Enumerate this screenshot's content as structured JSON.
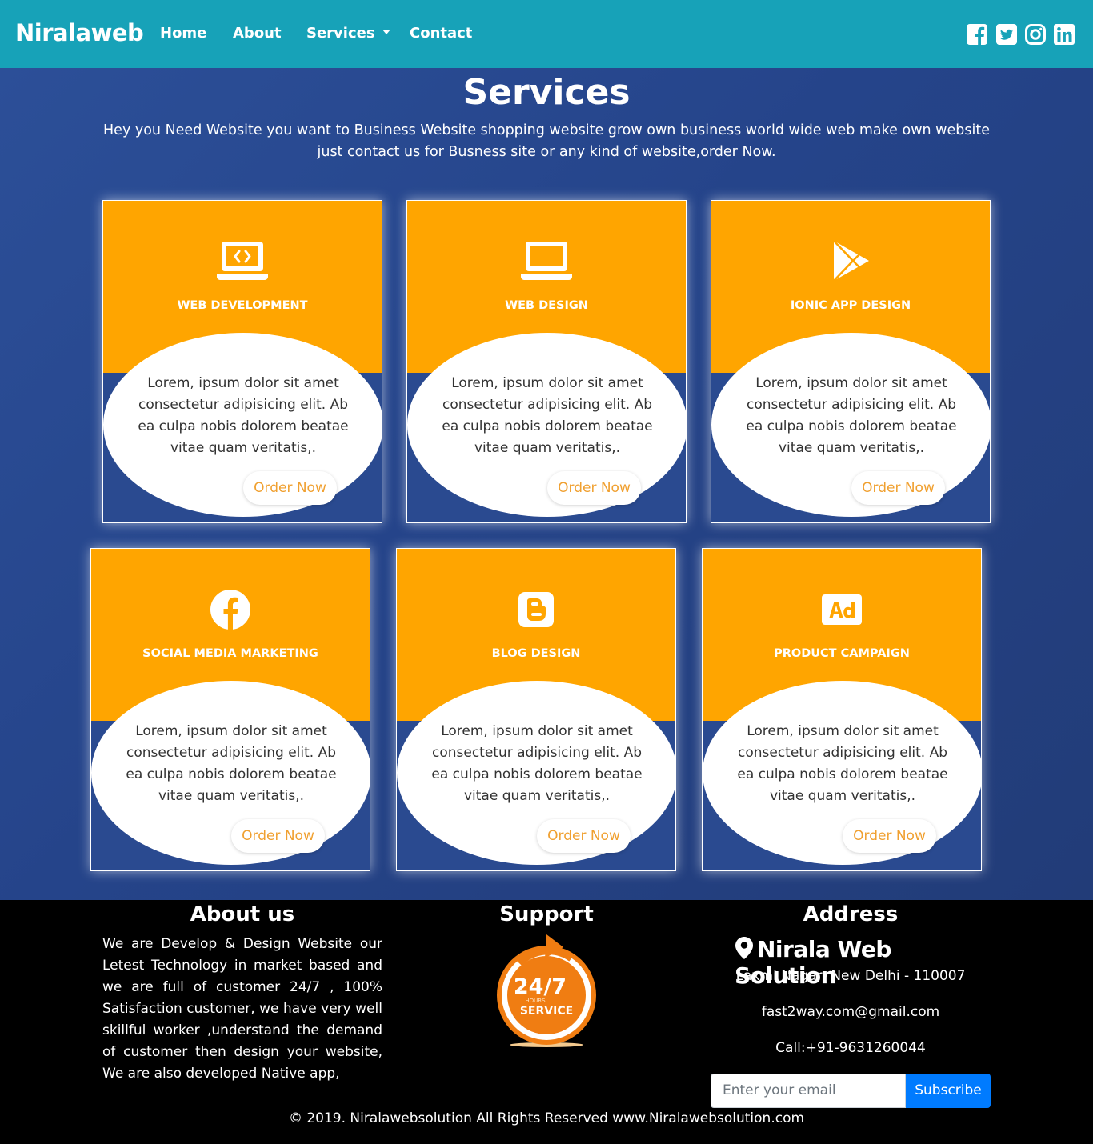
{
  "navbar": {
    "brand": "Niralaweb",
    "links": [
      "Home",
      "About",
      "Services",
      "Contact"
    ],
    "social_icons": [
      "facebook-square-icon",
      "twitter-square-icon",
      "instagram-icon",
      "linkedin-icon"
    ]
  },
  "hero": {
    "title": "Services",
    "description": "Hey you Need Website you want to Business Website shopping website grow own business world wide web make own website just contact us for Busness site or any kind of website,order Now."
  },
  "cards": [
    {
      "icon": "laptop-code-icon",
      "title": "WEB DEVELOPMENT",
      "text": "Lorem, ipsum dolor sit amet consectetur adipisicing elit. Ab ea culpa nobis dolorem beatae vitae quam veritatis,.",
      "button": "Order Now"
    },
    {
      "icon": "laptop-icon",
      "title": "WEB DESIGN",
      "text": "Lorem, ipsum dolor sit amet consectetur adipisicing elit. Ab ea culpa nobis dolorem beatae vitae quam veritatis,.",
      "button": "Order Now"
    },
    {
      "icon": "google-play-icon",
      "title": "IONIC APP DESIGN",
      "text": "Lorem, ipsum dolor sit amet consectetur adipisicing elit. Ab ea culpa nobis dolorem beatae vitae quam veritatis,.",
      "button": "Order Now"
    },
    {
      "icon": "facebook-icon",
      "title": "SOCIAL MEDIA MARKETING",
      "text": "Lorem, ipsum dolor sit amet consectetur adipisicing elit. Ab ea culpa nobis dolorem beatae vitae quam veritatis,.",
      "button": "Order Now"
    },
    {
      "icon": "blogger-icon",
      "title": "BLOG DESIGN",
      "text": "Lorem, ipsum dolor sit amet consectetur adipisicing elit. Ab ea culpa nobis dolorem beatae vitae quam veritatis,.",
      "button": "Order Now"
    },
    {
      "icon": "ad-icon",
      "title": "PRODUCT CAMPAIGN",
      "text": "Lorem, ipsum dolor sit amet consectetur adipisicing elit. Ab ea culpa nobis dolorem beatae vitae quam veritatis,.",
      "button": "Order Now"
    }
  ],
  "footer": {
    "about": {
      "title": "About us",
      "text": "We are Develop & Design Website our Letest Technology in market based and we are full of customer 24/7 , 100% Satisfaction customer, we have very well skillful worker ,understand the demand of customer then design your website, We are also developed Native app,"
    },
    "support": {
      "title": "Support",
      "badge_big": "24/7",
      "badge_small": "HOURS",
      "badge_word": "SERVICE"
    },
    "address": {
      "title": "Address",
      "company": "Nirala Web Solution",
      "location": "Laxmi Nagar, New Delhi - 110007",
      "email": "fast2way.com@gmail.com",
      "phone": "Call:+91-9631260044"
    },
    "subscribe": {
      "placeholder": "Enter your email",
      "button": "Subscribe"
    },
    "copyright": "© 2019. Niralawebsolution All Rights Reserved www.Niralawebsolution.com"
  },
  "colors": {
    "navbar": "#17a2b8",
    "card_top": "#ffa500",
    "card_bottom": "#2a4a90",
    "order_text": "#f0a030",
    "subscribe": "#007bff",
    "support_orange": "#f07d12"
  }
}
